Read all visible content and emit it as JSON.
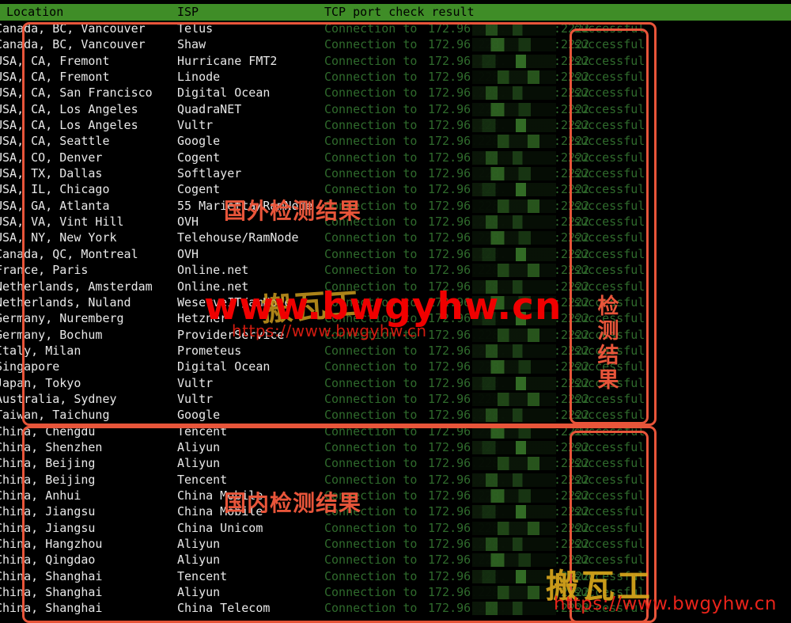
{
  "header": {
    "location_label": "Location",
    "isp_label": "ISP",
    "result_label": "TCP port check result",
    "bg_color": "#3f8d27",
    "text_color": "#000000"
  },
  "connection": {
    "prefix": "Connection to",
    "ip": "172.96.228.",
    "port": ":2222",
    "status": "successful"
  },
  "rows": [
    {
      "location": "Canada, BC, Vancouver",
      "isp": "Telus"
    },
    {
      "location": "Canada, BC, Vancouver",
      "isp": "Shaw"
    },
    {
      "location": "USA, CA, Fremont",
      "isp": "Hurricane FMT2"
    },
    {
      "location": "USA, CA, Fremont",
      "isp": "Linode"
    },
    {
      "location": "USA, CA, San Francisco",
      "isp": "Digital Ocean"
    },
    {
      "location": "USA, CA, Los Angeles",
      "isp": "QuadraNET"
    },
    {
      "location": "USA, CA, Los Angeles",
      "isp": "Vultr"
    },
    {
      "location": "USA, CA, Seattle",
      "isp": "Google"
    },
    {
      "location": "USA, CO, Denver",
      "isp": "Cogent"
    },
    {
      "location": "USA, TX, Dallas",
      "isp": "Softlayer"
    },
    {
      "location": "USA, IL, Chicago",
      "isp": "Cogent"
    },
    {
      "location": "USA, GA, Atlanta",
      "isp": "55 Marietta/RamNode"
    },
    {
      "location": "USA, VA, Vint Hill",
      "isp": "OVH"
    },
    {
      "location": "USA, NY, New York",
      "isp": "Telehouse/RamNode"
    },
    {
      "location": "Canada, QC, Montreal",
      "isp": "OVH"
    },
    {
      "location": "France, Paris",
      "isp": "Online.net"
    },
    {
      "location": "Netherlands, Amsterdam",
      "isp": "Online.net"
    },
    {
      "location": "Netherlands, Nuland",
      "isp": "WeserveIT/amNode"
    },
    {
      "location": "Germany, Nuremberg",
      "isp": "Hetzner"
    },
    {
      "location": "Germany, Bochum",
      "isp": "ProviderService"
    },
    {
      "location": "Italy, Milan",
      "isp": "Prometeus"
    },
    {
      "location": "Singapore",
      "isp": "Digital Ocean"
    },
    {
      "location": "Japan, Tokyo",
      "isp": "Vultr"
    },
    {
      "location": "Australia, Sydney",
      "isp": "Vultr"
    },
    {
      "location": "Taiwan, Taichung",
      "isp": "Google"
    },
    {
      "location": "China, Chengdu",
      "isp": "Tencent"
    },
    {
      "location": "China, Shenzhen",
      "isp": "Aliyun"
    },
    {
      "location": "China, Beijing",
      "isp": "Aliyun"
    },
    {
      "location": "China, Beijing",
      "isp": "Tencent"
    },
    {
      "location": "China, Anhui",
      "isp": "China Mobile"
    },
    {
      "location": "China, Jiangsu",
      "isp": "China Mobile"
    },
    {
      "location": "China, Jiangsu",
      "isp": "China Unicom"
    },
    {
      "location": "China, Hangzhou",
      "isp": "Aliyun"
    },
    {
      "location": "China, Qingdao",
      "isp": "Aliyun"
    },
    {
      "location": "China, Shanghai",
      "isp": "Tencent"
    },
    {
      "location": "China, Shanghai",
      "isp": "Aliyun"
    },
    {
      "location": "China, Shanghai",
      "isp": "China Telecom"
    }
  ],
  "annotations": {
    "overseas_label": "国外检测结果",
    "domestic_label": "国内检测结果",
    "vertical_label": "检测结果",
    "box_color": "#e8553a"
  },
  "watermarks": {
    "main": "www.bwgyhw.cn",
    "sub": "https://www.bwgyhw.cn",
    "cn_center": "搬瓦工",
    "cn_bottom_right": "搬瓦工",
    "url_bottom_right": "https://www.bwgyhw.cn",
    "red": "#f00000",
    "gold": "#d9a61c"
  }
}
